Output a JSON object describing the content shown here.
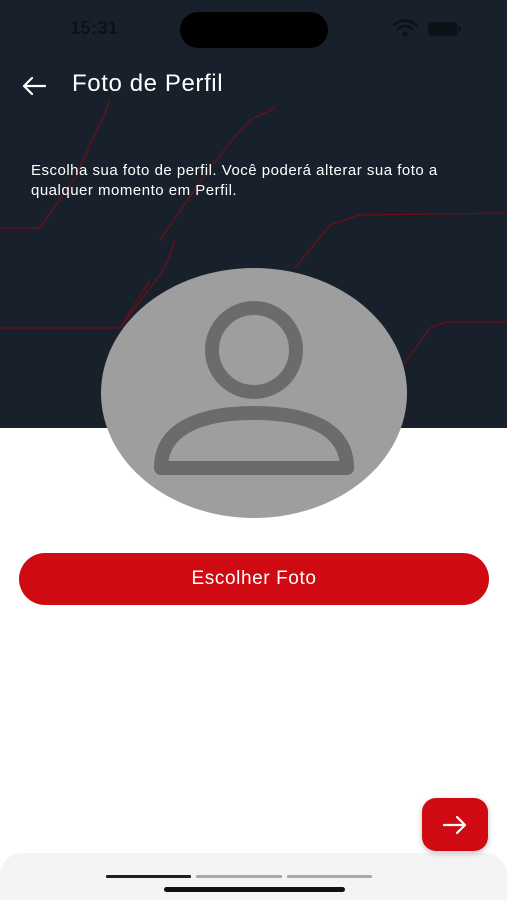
{
  "status_bar": {
    "time": "15:31",
    "icons": [
      "wifi-icon",
      "battery-icon"
    ]
  },
  "header": {
    "back_icon": "arrow-left-icon",
    "title": "Foto de Perfil"
  },
  "intro": {
    "text": "Escolha sua foto de perfil. Você poderá alterar sua foto a qualquer momento em Perfil."
  },
  "avatar": {
    "icon": "user-placeholder-icon"
  },
  "actions": {
    "choose_photo_label": "Escolher Foto",
    "next_icon": "arrow-right-icon"
  },
  "stepper": {
    "total_steps": 3,
    "current_step": 1
  },
  "colors": {
    "header_background": "#17202b",
    "accent": "#cf0a12",
    "circuit_lines": "#6b0f18",
    "avatar_background": "#9e9e9e",
    "avatar_icon": "#6b6b6b",
    "step_active": "#17202b",
    "step_inactive": "#a9a9a9"
  }
}
